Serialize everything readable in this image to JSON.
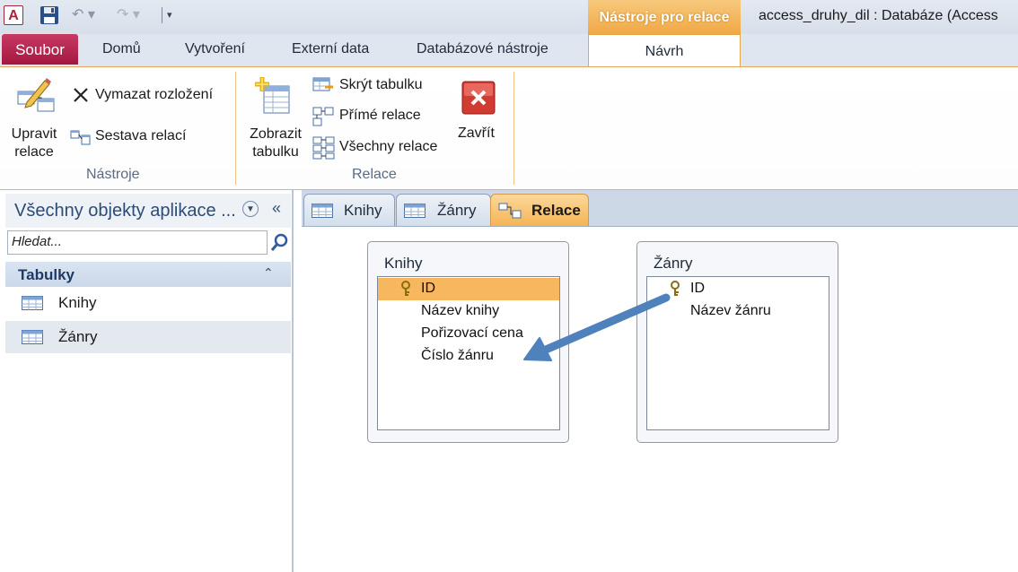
{
  "window": {
    "title": "access_druhy_dil : Databáze (Access",
    "context_tools": "Nástroje pro relace",
    "app_icon_letter": "A"
  },
  "quick_access": {
    "icons": [
      "save-icon",
      "undo-icon",
      "redo-icon",
      "customize-quick-access-icon"
    ]
  },
  "tabs": {
    "file": "Soubor",
    "home": "Domů",
    "create": "Vytvoření",
    "external": "Externí data",
    "dbtools": "Databázové nástroje",
    "design": "Návrh"
  },
  "ribbon": {
    "groups": {
      "tools": "Nástroje",
      "relations": "Relace"
    },
    "edit_relations": [
      "Upravit",
      "relace"
    ],
    "clear_layout": "Vymazat rozložení",
    "relation_report": "Sestava relací",
    "show_table": [
      "Zobrazit",
      "tabulku"
    ],
    "hide_table": "Skrýt tabulku",
    "direct_relations": "Přímé relace",
    "all_relations": "Všechny relace",
    "close": "Zavřít"
  },
  "nav": {
    "title": "Všechny objekty aplikace ...",
    "search_placeholder": "Hledat...",
    "group": "Tabulky",
    "items": [
      {
        "label": "Knihy",
        "selected": false
      },
      {
        "label": "Žánry",
        "selected": true
      }
    ]
  },
  "doc_tabs": [
    {
      "label": "Knihy",
      "icon": "table-icon",
      "active": false
    },
    {
      "label": "Žánry",
      "icon": "table-icon",
      "active": false
    },
    {
      "label": "Relace",
      "icon": "relationships-icon",
      "active": true
    }
  ],
  "tables": [
    {
      "name": "Knihy",
      "fields": [
        {
          "name": "ID",
          "key": true,
          "selected": true
        },
        {
          "name": "Název knihy",
          "key": false,
          "selected": false
        },
        {
          "name": "Pořizovací cena",
          "key": false,
          "selected": false
        },
        {
          "name": "Číslo žánru",
          "key": false,
          "selected": false
        }
      ]
    },
    {
      "name": "Žánry",
      "fields": [
        {
          "name": "ID",
          "key": true,
          "selected": false
        },
        {
          "name": "Název žánru",
          "key": false,
          "selected": false
        }
      ]
    }
  ],
  "annotation": {
    "arrow_color": "#4f81bd"
  },
  "colors": {
    "file_tab": "#a5173f",
    "context_tab": "#f0a845",
    "selected_field": "#f7b75f",
    "nav_title": "#2c4b75"
  }
}
